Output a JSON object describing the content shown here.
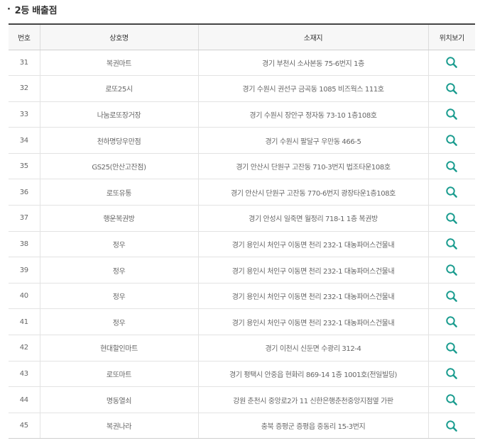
{
  "section": {
    "bullet": "·",
    "title": "2등 배출점"
  },
  "colors": {
    "accent": "#1a9c8f",
    "header_border": "#444444"
  },
  "table": {
    "headers": {
      "no": "번호",
      "name": "상호명",
      "address": "소재지",
      "map": "위치보기"
    },
    "map_icon": "search-icon",
    "rows": [
      {
        "no": "31",
        "name": "복권마트",
        "address": "경기 부천시 소사본동 75-6번지 1층"
      },
      {
        "no": "32",
        "name": "로또25시",
        "address": "경기 수원시 권선구 금곡동 1085 비즈웍스 111호"
      },
      {
        "no": "33",
        "name": "나눔로또장거장",
        "address": "경기 수원시 장안구 정자동 73-10 1층108호"
      },
      {
        "no": "34",
        "name": "천하명당우만점",
        "address": "경기 수원시 팔달구 우만동 466-5"
      },
      {
        "no": "35",
        "name": "GS25(안산고잔점)",
        "address": "경기 안산시 단원구 고잔동 710-3번지 법조타운108호"
      },
      {
        "no": "36",
        "name": "로또유통",
        "address": "경기 안산시 단원구 고잔동 770-6번지 광장타운1층108호"
      },
      {
        "no": "37",
        "name": "행운복권방",
        "address": "경기 안성시 일죽면 월정리 718-1 1층 복권방"
      },
      {
        "no": "38",
        "name": "정우",
        "address": "경기 용인시 처인구 이동면 천리 232-1 대농파머스건물내"
      },
      {
        "no": "39",
        "name": "정우",
        "address": "경기 용인시 처인구 이동면 천리 232-1 대농파머스건물내"
      },
      {
        "no": "40",
        "name": "정우",
        "address": "경기 용인시 처인구 이동면 천리 232-1 대농파머스건물내"
      },
      {
        "no": "41",
        "name": "정우",
        "address": "경기 용인시 처인구 이동면 천리 232-1 대농파머스건물내"
      },
      {
        "no": "42",
        "name": "현대할인마트",
        "address": "경기 이천시 신둔면 수광리 312-4"
      },
      {
        "no": "43",
        "name": "로또마트",
        "address": "경기 평택시 안중읍 현화리 869-14 1층 1001호(전일빌딩)"
      },
      {
        "no": "44",
        "name": "명동열쇠",
        "address": "강원 춘천시 중앙로2가 11 신한은행춘천중앙지점옆 가판"
      },
      {
        "no": "45",
        "name": "복권나라",
        "address": "충북 증평군 증평읍 중동리 15-3번지"
      }
    ]
  }
}
